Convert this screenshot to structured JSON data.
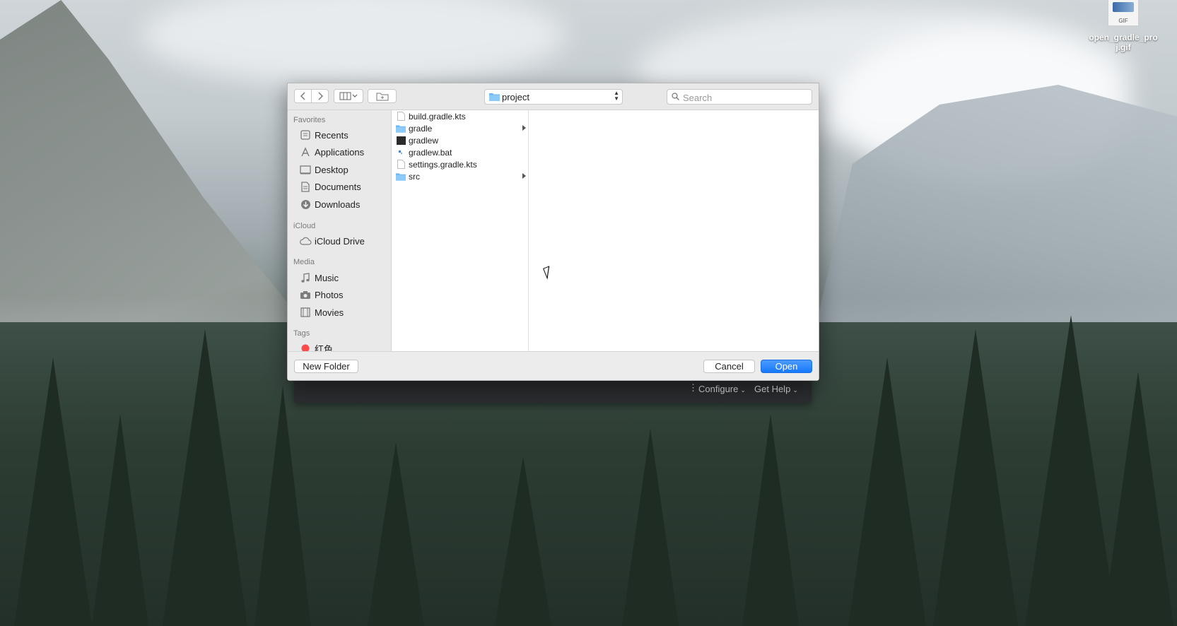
{
  "desktop": {
    "icon": {
      "badge": "GIF",
      "filename": "open_gradle_proj.gif"
    }
  },
  "behind_window": {
    "configure_label": "Configure",
    "get_help_label": "Get Help"
  },
  "dialog": {
    "path_popup": {
      "current_folder": "project"
    },
    "search": {
      "placeholder": "Search"
    },
    "sidebar": {
      "favorites_header": "Favorites",
      "favorites": [
        {
          "label": "Recents",
          "icon": "recents-icon"
        },
        {
          "label": "Applications",
          "icon": "applications-icon"
        },
        {
          "label": "Desktop",
          "icon": "desktop-icon"
        },
        {
          "label": "Documents",
          "icon": "documents-icon"
        },
        {
          "label": "Downloads",
          "icon": "downloads-icon"
        }
      ],
      "icloud_header": "iCloud",
      "icloud": [
        {
          "label": "iCloud Drive",
          "icon": "cloud-icon"
        }
      ],
      "media_header": "Media",
      "media": [
        {
          "label": "Music",
          "icon": "music-icon"
        },
        {
          "label": "Photos",
          "icon": "camera-icon"
        },
        {
          "label": "Movies",
          "icon": "film-icon"
        }
      ],
      "tags_header": "Tags",
      "tags": [
        {
          "label": "红色",
          "color": "#ff4a4a"
        }
      ]
    },
    "files": [
      {
        "name": "build.gradle.kts",
        "type": "document",
        "has_children": false
      },
      {
        "name": "gradle",
        "type": "folder",
        "has_children": true
      },
      {
        "name": "gradlew",
        "type": "executable",
        "has_children": false
      },
      {
        "name": "gradlew.bat",
        "type": "script",
        "has_children": false
      },
      {
        "name": "settings.gradle.kts",
        "type": "document",
        "has_children": false
      },
      {
        "name": "src",
        "type": "folder",
        "has_children": true
      }
    ],
    "buttons": {
      "new_folder": "New Folder",
      "cancel": "Cancel",
      "open": "Open"
    },
    "colors": {
      "accent": "#1679ff",
      "folder": "#6cb6f5"
    }
  }
}
